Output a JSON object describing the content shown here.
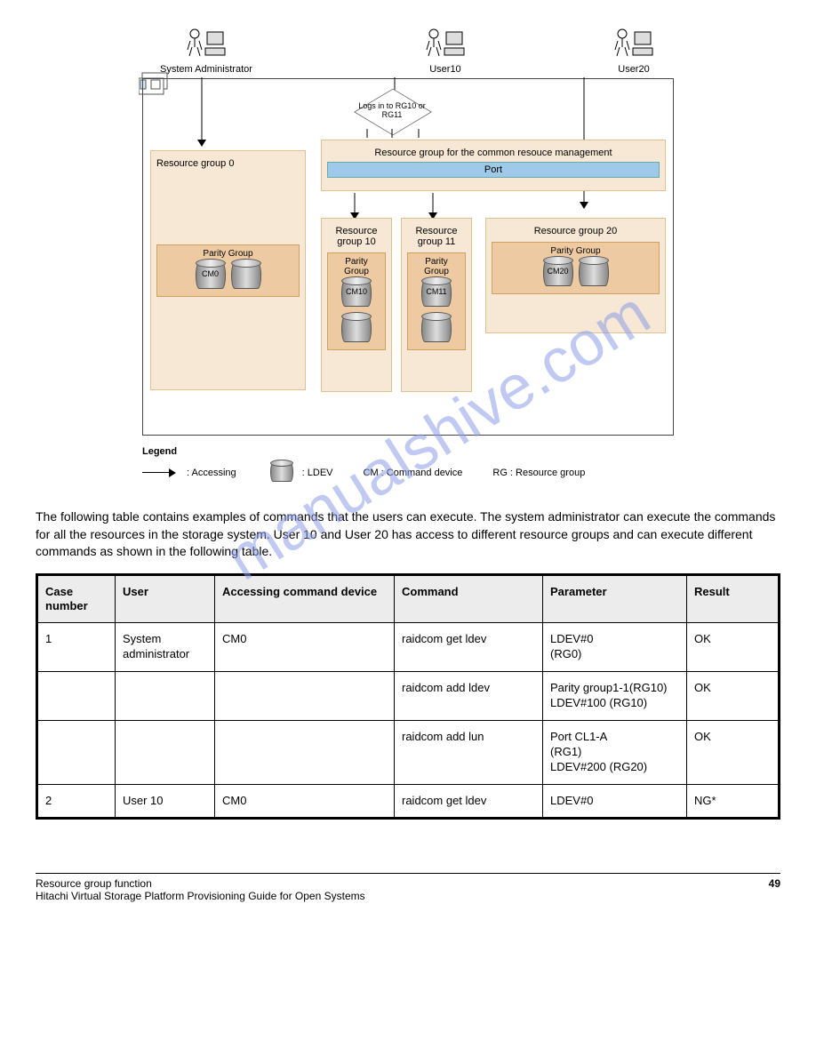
{
  "watermark": "manualshive.com",
  "diagram": {
    "actors": [
      "System Administrator",
      "User10",
      "User20"
    ],
    "decision": "Logs in to RG10 or RG11",
    "rg0": {
      "title": "Resource group 0",
      "parity": "Parity Group",
      "cm": "CM0"
    },
    "common": {
      "title": "Resource group for the common resouce management",
      "port": "Port"
    },
    "rg10": {
      "title": "Resource group 10",
      "parity": "Parity Group",
      "cm": "CM10"
    },
    "rg11": {
      "title": "Resource group 11",
      "parity": "Parity Group",
      "cm": "CM11"
    },
    "rg20": {
      "title": "Resource group 20",
      "parity": "Parity Group",
      "cm": "CM20"
    },
    "legend": {
      "title": "Legend",
      "accessing": ": Accessing",
      "ldev": ": LDEV",
      "cm": "CM : Command device",
      "rg": "RG : Resource group"
    }
  },
  "intro": "The following table contains examples of commands that the users can execute. The system administrator can execute the commands for all the resources in the storage system. User 10 and User 20 has access to different resource groups and can execute different commands as shown in the following table.",
  "table": {
    "headers": [
      "Case number",
      "User",
      "Accessing command device",
      "Command",
      "Parameter",
      "Result"
    ],
    "rows": [
      [
        "1",
        "System administrator",
        "CM0",
        "raidcom get ldev",
        "LDEV#0\n(RG0)",
        "OK"
      ],
      [
        "",
        "",
        "",
        "raidcom add ldev",
        "Parity group1-1(RG10)\nLDEV#100 (RG10)",
        "OK"
      ],
      [
        "",
        "",
        "",
        "raidcom add lun",
        "Port CL1-A\n(RG1)\nLDEV#200 (RG20)",
        "OK"
      ],
      [
        "2",
        "User 10",
        "CM0",
        "raidcom get ldev",
        "LDEV#0",
        "NG*"
      ]
    ]
  },
  "footer": {
    "left_line1": "Resource group function",
    "left_line2": "Hitachi Virtual Storage Platform Provisioning Guide for Open Systems",
    "page": "49"
  }
}
